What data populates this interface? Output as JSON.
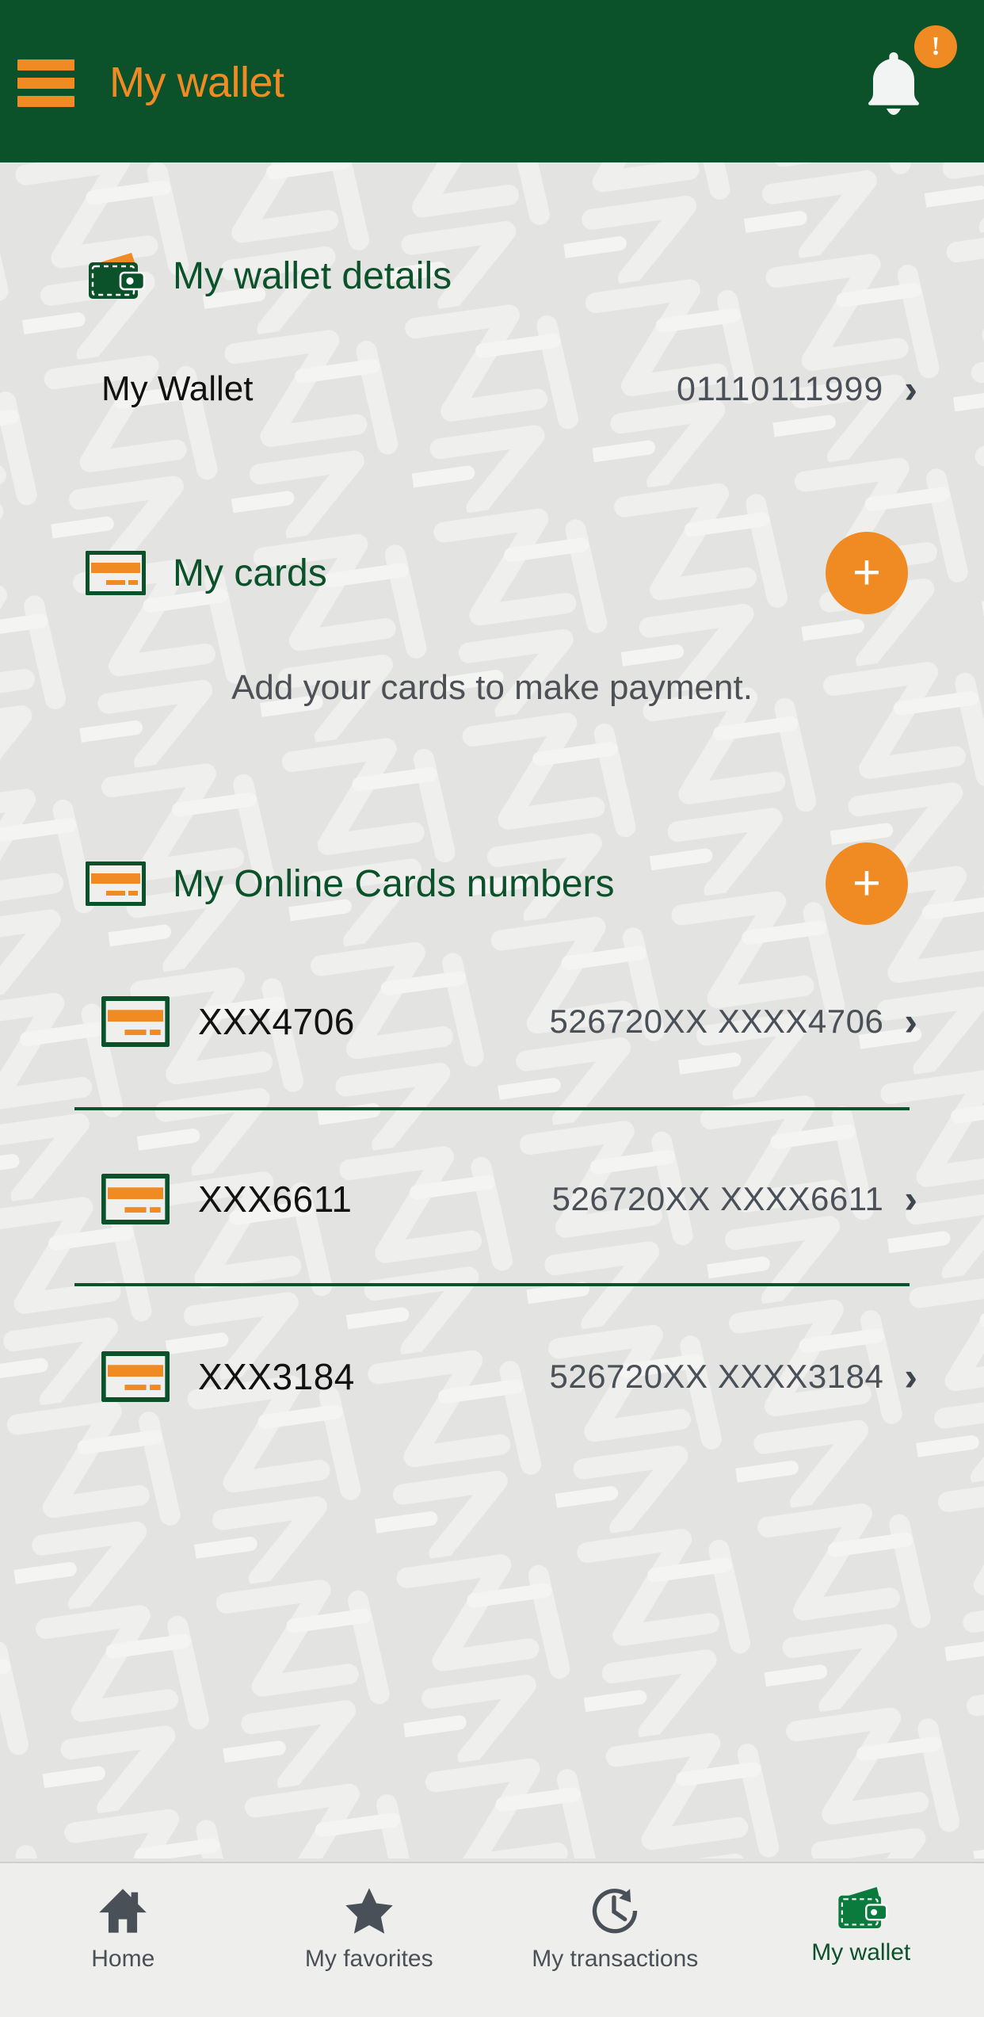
{
  "header": {
    "title": "My wallet",
    "menu_icon": "hamburger-menu-icon",
    "bell_icon": "notification-bell-icon",
    "badge_mark": "!",
    "bg_color": "#0b5129",
    "accent_color": "#f08a22"
  },
  "wallet_details": {
    "icon": "wallet-icon",
    "title": "My wallet details",
    "row": {
      "label": "My Wallet",
      "number": "01110111999",
      "chevron": "›"
    }
  },
  "my_cards": {
    "icon": "credit-card-icon",
    "title": "My cards",
    "add_button_label": "+",
    "empty_hint": "Add your cards to make payment."
  },
  "online_cards": {
    "icon": "credit-card-icon",
    "title": "My Online Cards numbers",
    "add_button_label": "+",
    "items": [
      {
        "alias": "XXX4706",
        "number": "526720XX XXXX4706",
        "chevron": "›"
      },
      {
        "alias": "XXX6611",
        "number": "526720XX XXXX6611",
        "chevron": "›"
      },
      {
        "alias": "XXX3184",
        "number": "526720XX XXXX3184",
        "chevron": "›"
      }
    ]
  },
  "tabbar": {
    "items": [
      {
        "label": "Home",
        "icon": "home-icon",
        "active": false
      },
      {
        "label": "My favorites",
        "icon": "star-icon",
        "active": false
      },
      {
        "label": "My transactions",
        "icon": "clock-history-icon",
        "active": false
      },
      {
        "label": "My wallet",
        "icon": "wallet-icon",
        "active": true
      }
    ]
  },
  "colors": {
    "brand_green": "#0b5129",
    "brand_orange": "#f08a22",
    "page_background": "#e3e3e1",
    "muted_text": "#4a5057"
  }
}
